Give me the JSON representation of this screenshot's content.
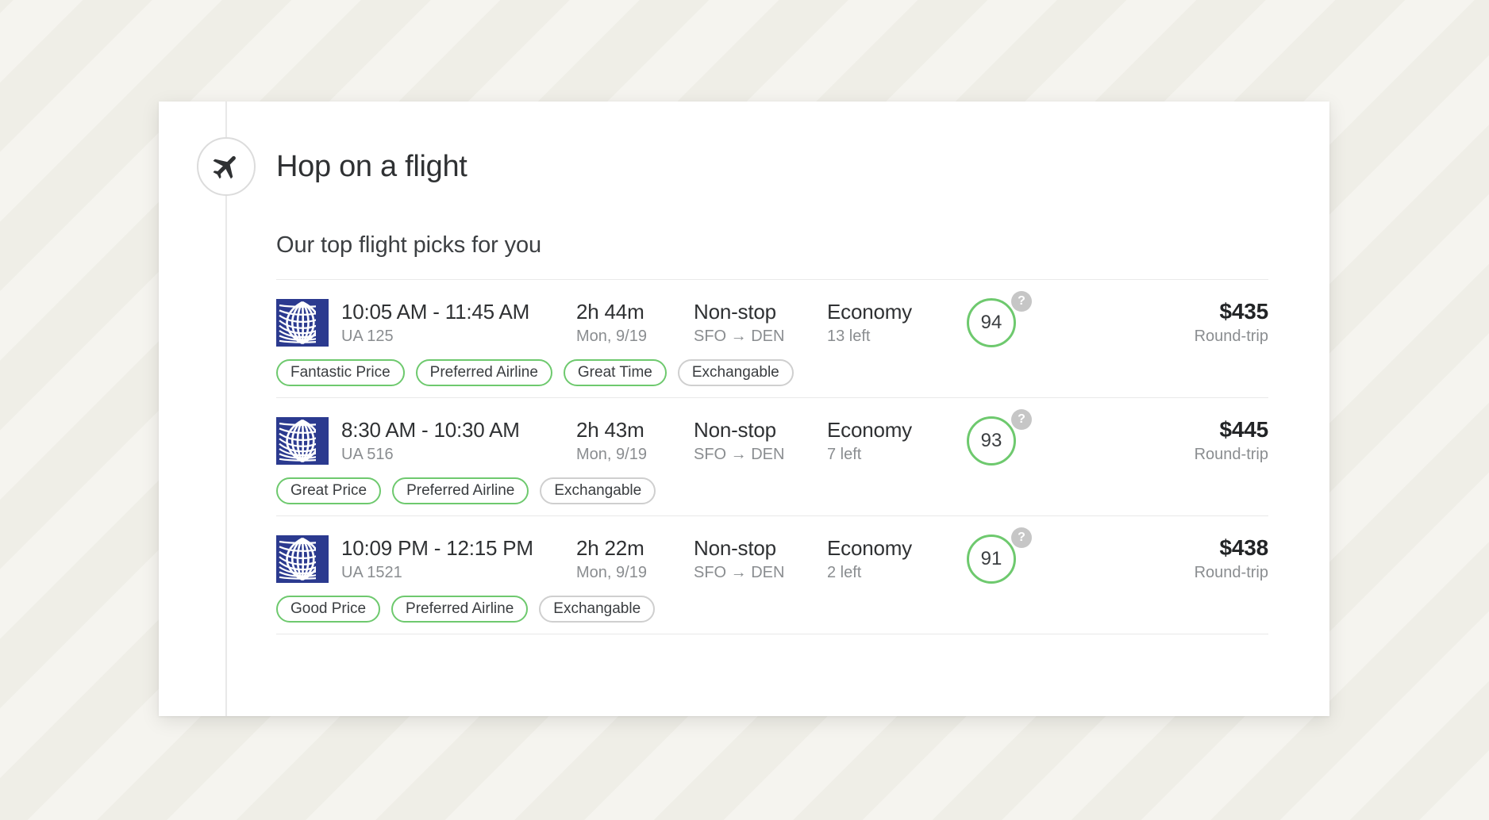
{
  "header": {
    "title": "Hop on a flight",
    "icon": "airplane-icon"
  },
  "section": {
    "subtitle": "Our top flight picks for you"
  },
  "colors": {
    "background": "#f5f4ef",
    "card": "#ffffff",
    "accent_green": "#6ec96e",
    "neutral_border": "#cfcfcf",
    "airline_blue": "#2b3a8f",
    "text_primary": "#2f3133",
    "text_secondary": "#8a8d90"
  },
  "flights": [
    {
      "airline_logo": "united-airlines-globe-logo",
      "time_range": "10:05 AM - 11:45 AM",
      "flight_number": "UA 125",
      "duration": "2h 44m",
      "date": "Mon, 9/19",
      "stops": "Non-stop",
      "route": "SFO → DEN",
      "cabin": "Economy",
      "seats_left": "13 left",
      "score": "94",
      "score_help": "?",
      "price": "$435",
      "price_type": "Round-trip",
      "tags": [
        {
          "label": "Fantastic Price",
          "style": "green"
        },
        {
          "label": "Preferred Airline",
          "style": "green"
        },
        {
          "label": "Great Time",
          "style": "green"
        },
        {
          "label": "Exchangable",
          "style": "neutral"
        }
      ]
    },
    {
      "airline_logo": "united-airlines-globe-logo",
      "time_range": "8:30 AM - 10:30 AM",
      "flight_number": "UA 516",
      "duration": "2h 43m",
      "date": "Mon, 9/19",
      "stops": "Non-stop",
      "route": "SFO → DEN",
      "cabin": "Economy",
      "seats_left": "7 left",
      "score": "93",
      "score_help": "?",
      "price": "$445",
      "price_type": "Round-trip",
      "tags": [
        {
          "label": "Great Price",
          "style": "green"
        },
        {
          "label": "Preferred Airline",
          "style": "green"
        },
        {
          "label": "Exchangable",
          "style": "neutral"
        }
      ]
    },
    {
      "airline_logo": "united-airlines-globe-logo",
      "time_range": "10:09 PM - 12:15 PM",
      "flight_number": "UA 1521",
      "duration": "2h 22m",
      "date": "Mon, 9/19",
      "stops": "Non-stop",
      "route": "SFO → DEN",
      "cabin": "Economy",
      "seats_left": "2 left",
      "score": "91",
      "score_help": "?",
      "price": "$438",
      "price_type": "Round-trip",
      "tags": [
        {
          "label": "Good Price",
          "style": "green"
        },
        {
          "label": "Preferred Airline",
          "style": "green"
        },
        {
          "label": "Exchangable",
          "style": "neutral"
        }
      ]
    }
  ]
}
